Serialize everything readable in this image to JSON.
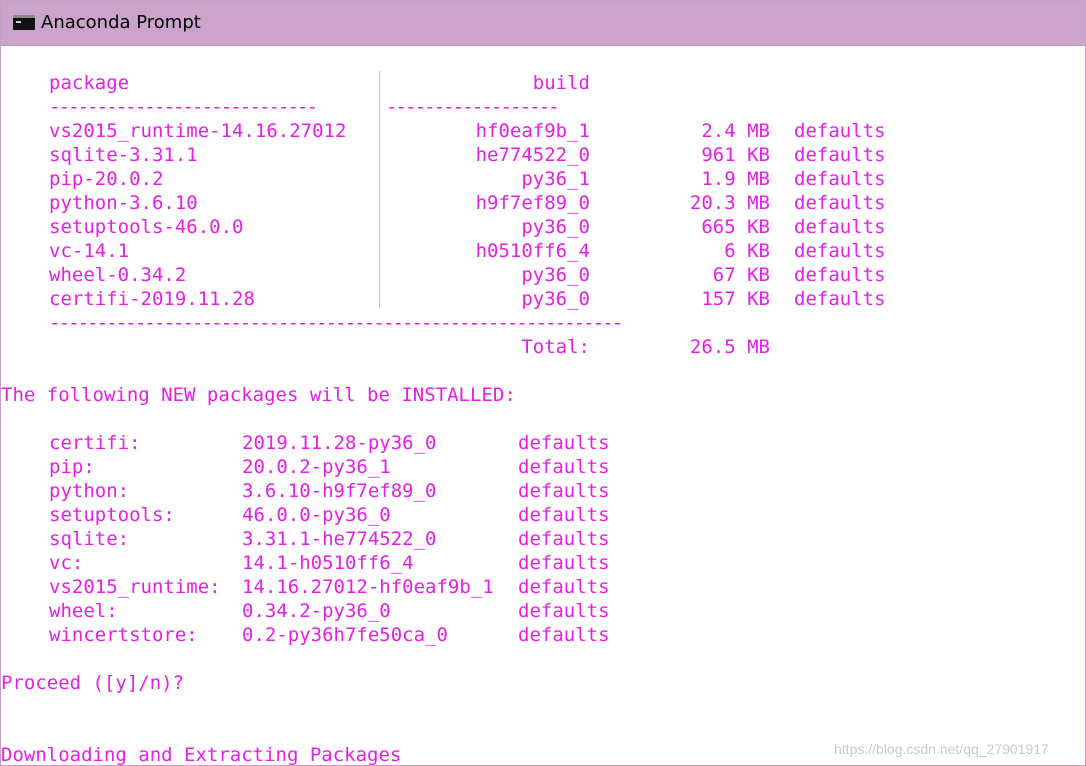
{
  "window": {
    "title": "Anaconda Prompt",
    "icon": "terminal-icon",
    "titlebar_color": "#cca3ca",
    "text_color": "#e61ee6"
  },
  "table": {
    "header_package": "package",
    "header_build": "build",
    "rule_left": "----------------------------",
    "rule_right": "------------------",
    "rows": [
      {
        "package": "vs2015_runtime-14.16.27012",
        "build": "hf0eaf9b_1",
        "size": "2.4 MB",
        "channel": "defaults"
      },
      {
        "package": "sqlite-3.31.1",
        "build": "he774522_0",
        "size": "961 KB",
        "channel": "defaults"
      },
      {
        "package": "pip-20.0.2",
        "build": "py36_1",
        "size": "1.9 MB",
        "channel": "defaults"
      },
      {
        "package": "python-3.6.10",
        "build": "h9f7ef89_0",
        "size": "20.3 MB",
        "channel": "defaults"
      },
      {
        "package": "setuptools-46.0.0",
        "build": "py36_0",
        "size": "665 KB",
        "channel": "defaults"
      },
      {
        "package": "vc-14.1",
        "build": "h0510ff6_4",
        "size": "6 KB",
        "channel": "defaults"
      },
      {
        "package": "wheel-0.34.2",
        "build": "py36_0",
        "size": "67 KB",
        "channel": "defaults"
      },
      {
        "package": "certifi-2019.11.28",
        "build": "py36_0",
        "size": "157 KB",
        "channel": "defaults"
      }
    ],
    "bottom_rule": "------------------------------------------------------------",
    "total_label": "Total:",
    "total_value": "26.5 MB"
  },
  "install": {
    "heading": "The following NEW packages will be INSTALLED:",
    "rows": [
      {
        "name": "certifi:",
        "spec": "2019.11.28-py36_0",
        "channel": "defaults"
      },
      {
        "name": "pip:",
        "spec": "20.0.2-py36_1",
        "channel": "defaults"
      },
      {
        "name": "python:",
        "spec": "3.6.10-h9f7ef89_0",
        "channel": "defaults"
      },
      {
        "name": "setuptools:",
        "spec": "46.0.0-py36_0",
        "channel": "defaults"
      },
      {
        "name": "sqlite:",
        "spec": "3.31.1-he774522_0",
        "channel": "defaults"
      },
      {
        "name": "vc:",
        "spec": "14.1-h0510ff6_4",
        "channel": "defaults"
      },
      {
        "name": "vs2015_runtime:",
        "spec": "14.16.27012-hf0eaf9b_1",
        "channel": "defaults"
      },
      {
        "name": "wheel:",
        "spec": "0.34.2-py36_0",
        "channel": "defaults"
      },
      {
        "name": "wincertstore:",
        "spec": "0.2-py36h7fe50ca_0",
        "channel": "defaults"
      }
    ]
  },
  "prompt": "Proceed ([y]/n)?",
  "status": "Downloading and Extracting Packages",
  "watermark": "https://blog.csdn.net/qq_27901917"
}
